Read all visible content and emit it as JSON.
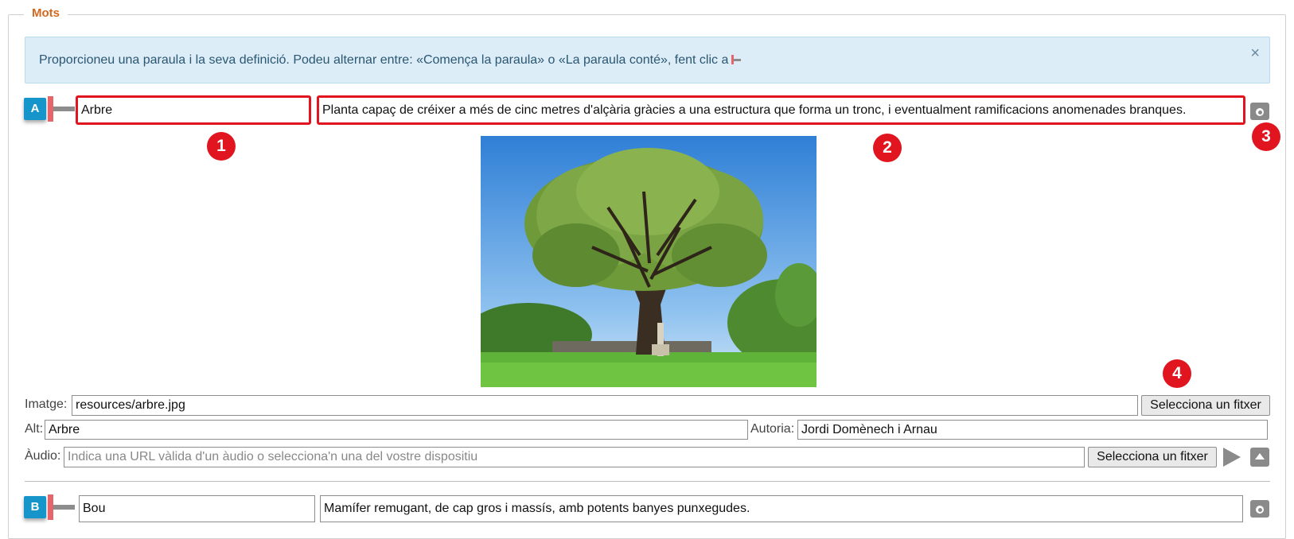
{
  "legend": "Mots",
  "alert": {
    "text": "Proporcioneu una paraula i la seva definició. Podeu alternar entre: «Comença la paraula» o «La paraula conté», fent clic a",
    "close": "×"
  },
  "entries": [
    {
      "letter": "A",
      "word": "Arbre",
      "definition": "Planta capaç de créixer a més de cinc metres d'alçària gràcies a una estructura que forma un tronc, i eventualment ramificacions anomenades branques.",
      "image_label": "Imatge:",
      "image_path": "resources/arbre.jpg",
      "select_file": "Selecciona un fitxer",
      "alt_label": "Alt:",
      "alt_value": "Arbre",
      "author_label": "Autoria:",
      "author_value": "Jordi Domènech i Arnau",
      "audio_label": "Àudio:",
      "audio_placeholder": "Indica una URL vàlida d'un àudio o selecciona'n una del vostre dispositiu",
      "audio_select": "Selecciona un fitxer"
    },
    {
      "letter": "B",
      "word": "Bou",
      "definition": "Mamífer remugant, de cap gros i massís, amb potents banyes punxegudes."
    }
  ],
  "badges": [
    "1",
    "2",
    "3",
    "4"
  ],
  "icons": {
    "toggle": "word-mode-toggle-icon",
    "camera": "camera-icon",
    "play": "play-icon",
    "collapse": "collapse-up-icon"
  },
  "colors": {
    "legend": "#d2691e",
    "letter_badge": "#1595c9",
    "highlight": "#e0151f",
    "alert_bg": "#dcedf7"
  }
}
